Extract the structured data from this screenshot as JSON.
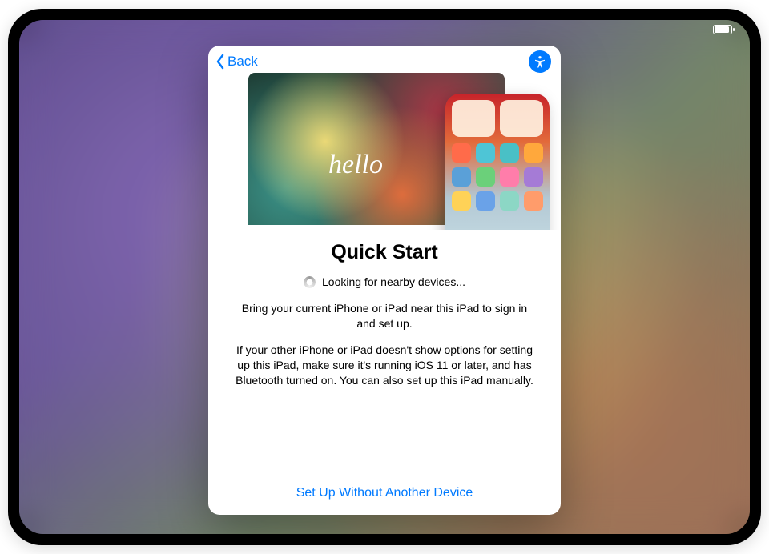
{
  "sheet": {
    "back_label": "Back",
    "hero_greeting": "hello",
    "title": "Quick Start",
    "status_text": "Looking for nearby devices...",
    "paragraph1": "Bring your current iPhone or iPad near this iPad to sign in and set up.",
    "paragraph2": "If your other iPhone or iPad doesn't show options for setting up this iPad, make sure it's running iOS 11 or later, and has Bluetooth turned on. You can also set up this iPad manually.",
    "bottom_link": "Set Up Without Another Device"
  },
  "icons": {
    "back": "chevron-left-icon",
    "accessibility": "accessibility-icon",
    "battery": "battery-icon",
    "spinner": "spinner-icon"
  }
}
